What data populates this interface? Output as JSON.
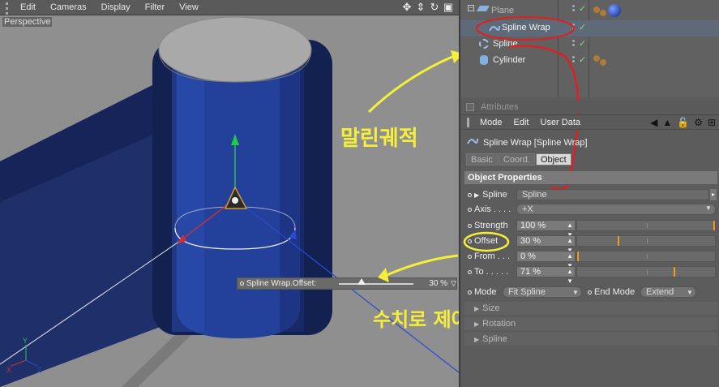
{
  "viewport": {
    "menu": [
      "Edit",
      "Cameras",
      "Display",
      "Filter",
      "View"
    ],
    "label": "Perspective",
    "nav_icons": [
      "move-icon",
      "dolly-icon",
      "rotate-icon",
      "maximize-icon"
    ],
    "hud": {
      "label": "Spline Wrap.Offset:",
      "value": "30 %",
      "fraction": 0.3
    },
    "axes": {
      "y": "Y",
      "x": "X",
      "z": "Z"
    }
  },
  "objects": {
    "rows": [
      {
        "name": "Plane",
        "icon": "plane-icon"
      },
      {
        "name": "Spline Wrap",
        "icon": "spline-wrap-icon"
      },
      {
        "name": "Spline",
        "icon": "spline-icon"
      },
      {
        "name": "Cylinder",
        "icon": "cylinder-icon"
      }
    ]
  },
  "attributes": {
    "title": "Attributes",
    "menu": [
      "Mode",
      "Edit",
      "User Data"
    ],
    "object_name": "Spline Wrap [Spline Wrap]",
    "tabs": [
      "Basic",
      "Coord.",
      "Object"
    ],
    "active_tab": "Object",
    "section": "Object Properties",
    "props": {
      "spline": {
        "label": "Spline",
        "value": "Spline"
      },
      "axis": {
        "label": "Axis . . . .",
        "value": "+X"
      },
      "strength": {
        "label": "Strength",
        "value": "100 %",
        "fraction": 1.0
      },
      "offset": {
        "label": "Offset",
        "value": "30 %",
        "fraction": 0.3
      },
      "from": {
        "label": "From . . .",
        "value": "0 %",
        "fraction": 0.0
      },
      "to": {
        "label": "To . . . . .",
        "value": "71 %",
        "fraction": 0.71
      }
    },
    "mode": {
      "label": "Mode",
      "value": "Fit Spline"
    },
    "end_mode": {
      "label": "End Mode",
      "value": "Extend"
    },
    "collapsed": [
      "Size",
      "Rotation",
      "Spline"
    ]
  },
  "annotations": {
    "note1": "말린궤적",
    "note2": "수치로 제어"
  },
  "colors": {
    "accent_orange": "#f09a1a",
    "annotation": "#f5ef3a",
    "highlight_red": "#e02020",
    "cylinder_blue": "#23409a"
  }
}
